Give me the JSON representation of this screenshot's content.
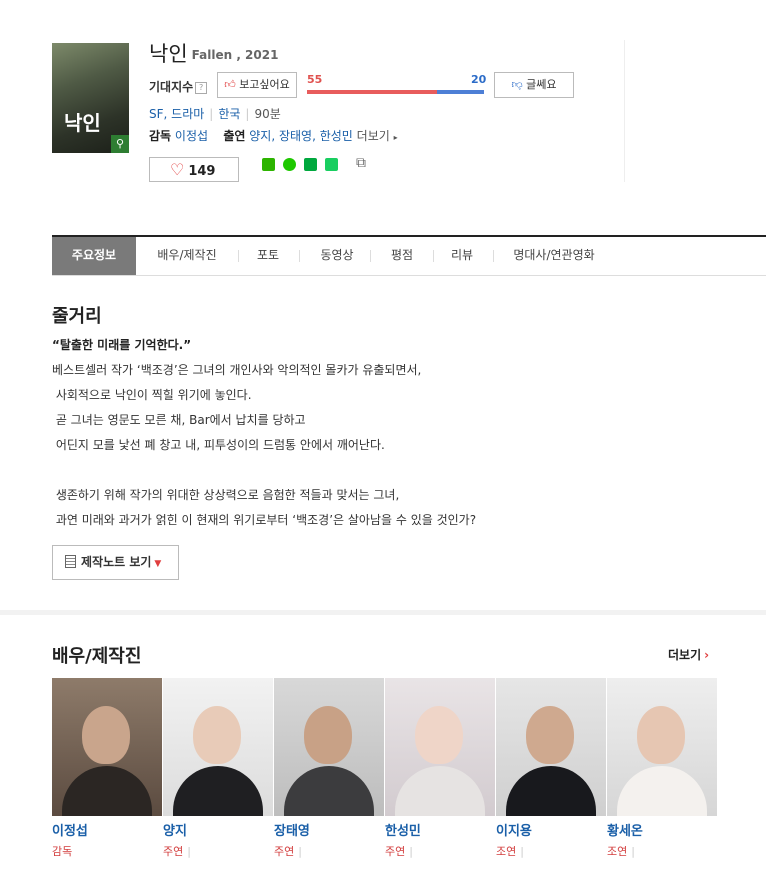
{
  "movie": {
    "title": "낙인",
    "subtitle": "Fallen , 2021",
    "poster_text": "낙인",
    "genres": "SF, 드라마",
    "country": "한국",
    "runtime": "90분",
    "director_label": "감독",
    "director": "이정섭",
    "cast_label": "출연",
    "cast_list": "양지, 장태영, 한성민",
    "more_label": "더보기",
    "like_count": "149"
  },
  "expectation": {
    "label": "기대지수",
    "help": "?",
    "want_label": "보고싶어요",
    "nowant_label": "글쎄요",
    "want_value": 55,
    "nowant_value": 20,
    "want_text": "55",
    "nowant_text": "20",
    "colors": {
      "want": "#e85c5c",
      "nowant": "#4d7fd6"
    }
  },
  "tabs": [
    "주요정보",
    "배우/제작진",
    "포토",
    "동영상",
    "평점",
    "리뷰",
    "명대사/연관영화"
  ],
  "synopsis": {
    "heading": "줄거리",
    "tagline": "“탈출한 미래를 기억한다.”",
    "lines": [
      "베스트셀러 작가 ‘백조경’은 그녀의 개인사와 악의적인 몰카가 유출되면서,",
      " 사회적으로 낙인이 찍힐 위기에 놓인다.",
      " 곧 그녀는 영문도 모른 채, Bar에서 납치를 당하고",
      " 어딘지 모를 낯선 폐 창고 내, 피투성이의 드럼통 안에서 깨어난다.",
      "",
      " 생존하기 위해 작가의 위대한 상상력으로 음험한 적들과 맞서는 그녀,",
      " 과연 미래와 과거가 얽힌 이 현재의 위기로부터 ‘백조경’은 살아남을 수 있을 것인가?"
    ],
    "note_button": "제작노트 보기"
  },
  "cast_section": {
    "heading": "배우/제작진",
    "more": "더보기",
    "people": [
      {
        "name": "이정섭",
        "role": "감독"
      },
      {
        "name": "양지",
        "role": "주연"
      },
      {
        "name": "장태영",
        "role": "주연"
      },
      {
        "name": "한성민",
        "role": "주연"
      },
      {
        "name": "이지용",
        "role": "조연"
      },
      {
        "name": "황세온",
        "role": "조연"
      }
    ]
  }
}
